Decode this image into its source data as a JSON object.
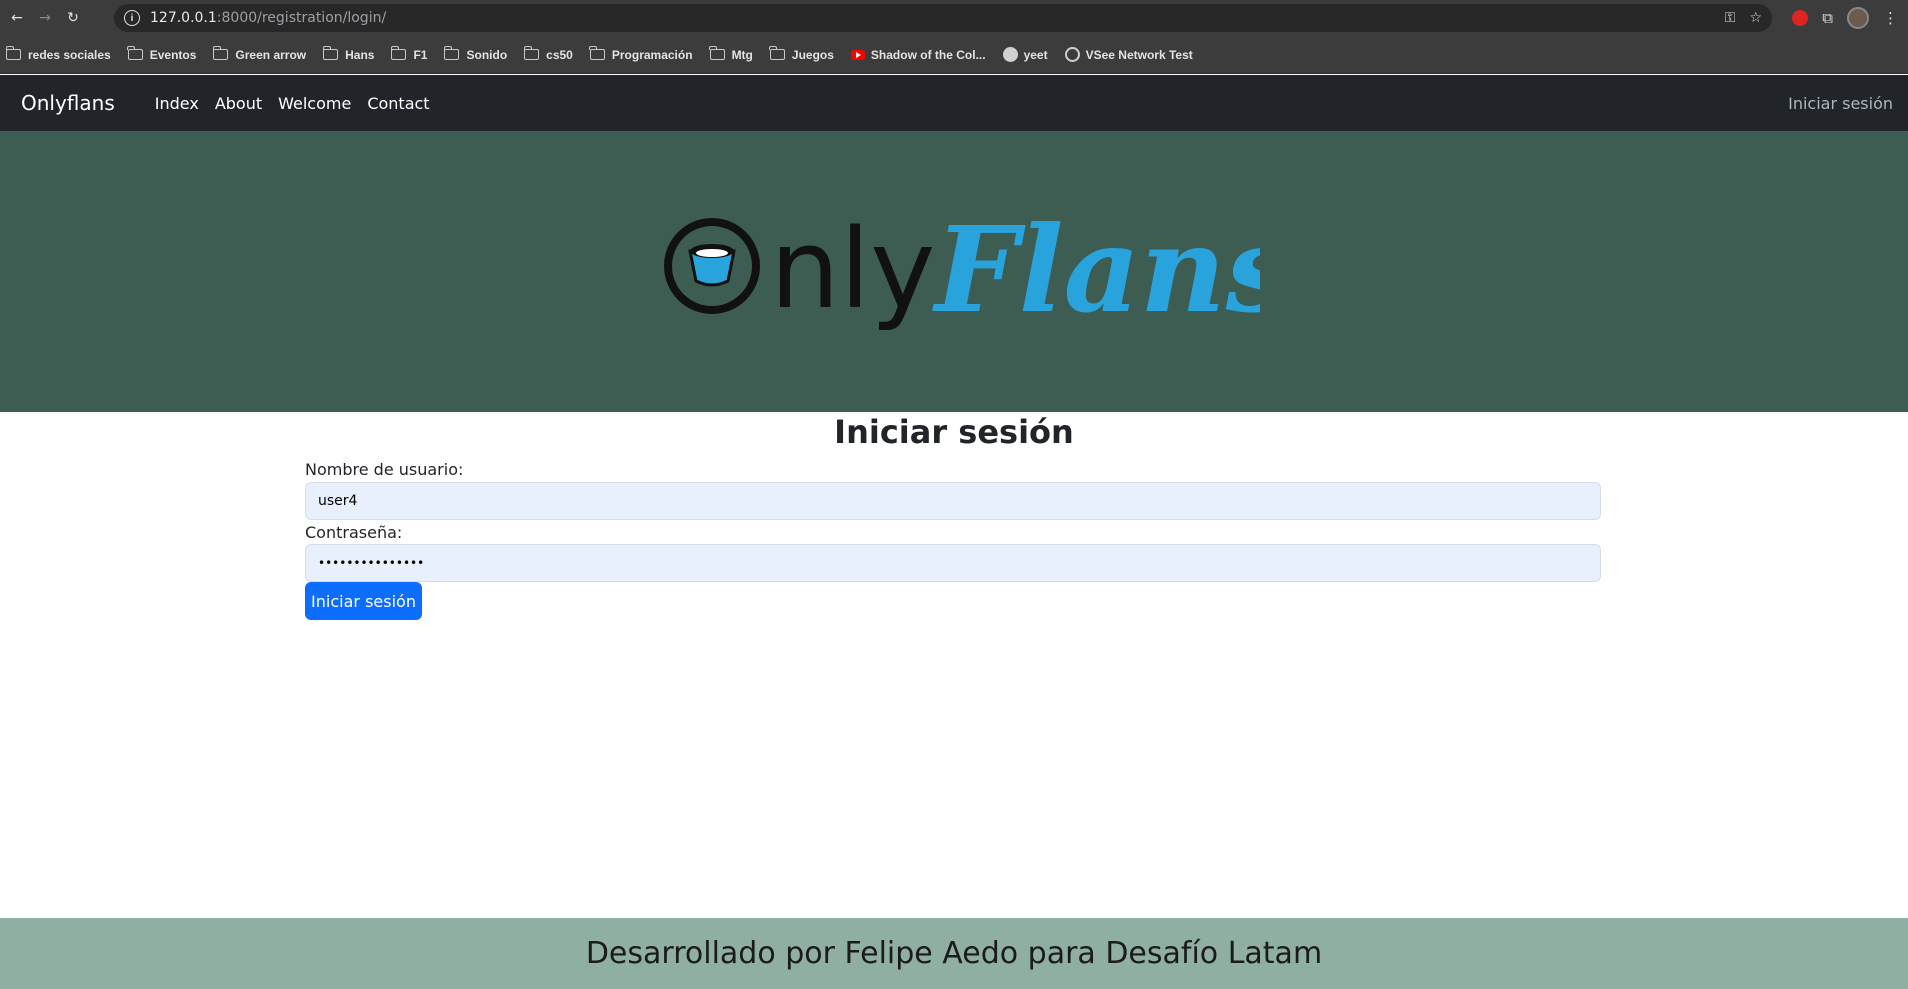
{
  "browser": {
    "url_host": "127.0.0.1",
    "url_rest": ":8000/registration/login/",
    "bookmarks": [
      {
        "label": "redes sociales",
        "icon": "folder-icon"
      },
      {
        "label": "Eventos",
        "icon": "folder-icon"
      },
      {
        "label": "Green arrow",
        "icon": "folder-icon"
      },
      {
        "label": "Hans",
        "icon": "folder-icon"
      },
      {
        "label": "F1",
        "icon": "folder-icon"
      },
      {
        "label": "Sonido",
        "icon": "folder-icon"
      },
      {
        "label": "cs50",
        "icon": "folder-icon"
      },
      {
        "label": "Programación",
        "icon": "folder-icon"
      },
      {
        "label": "Mtg",
        "icon": "folder-icon"
      },
      {
        "label": "Juegos",
        "icon": "folder-icon"
      },
      {
        "label": "Shadow of the Col...",
        "icon": "youtube-icon"
      },
      {
        "label": "yeet",
        "icon": "github-icon"
      },
      {
        "label": "VSee Network Test",
        "icon": "globe-icon"
      }
    ]
  },
  "navbar": {
    "brand": "Onlyflans",
    "links": [
      "Index",
      "About",
      "Welcome",
      "Contact"
    ],
    "login": "Iniciar sesión"
  },
  "hero": {
    "logo_text_dark": "nly",
    "logo_text_script": "Flans",
    "colors": {
      "background": "#3d5d53",
      "script": "#29a3dc"
    }
  },
  "login": {
    "title": "Iniciar sesión",
    "username_label": "Nombre de usuario:",
    "username_value": "user4",
    "password_label": "Contraseña:",
    "password_value": "•••••••••••••••",
    "submit_label": "Iniciar sesión"
  },
  "footer": {
    "text": "Desarrollado por Felipe Aedo para Desafío Latam",
    "color": "#8fafa2"
  },
  "colors": {
    "navbar": "#212529",
    "primary_button": "#0d6efd"
  }
}
